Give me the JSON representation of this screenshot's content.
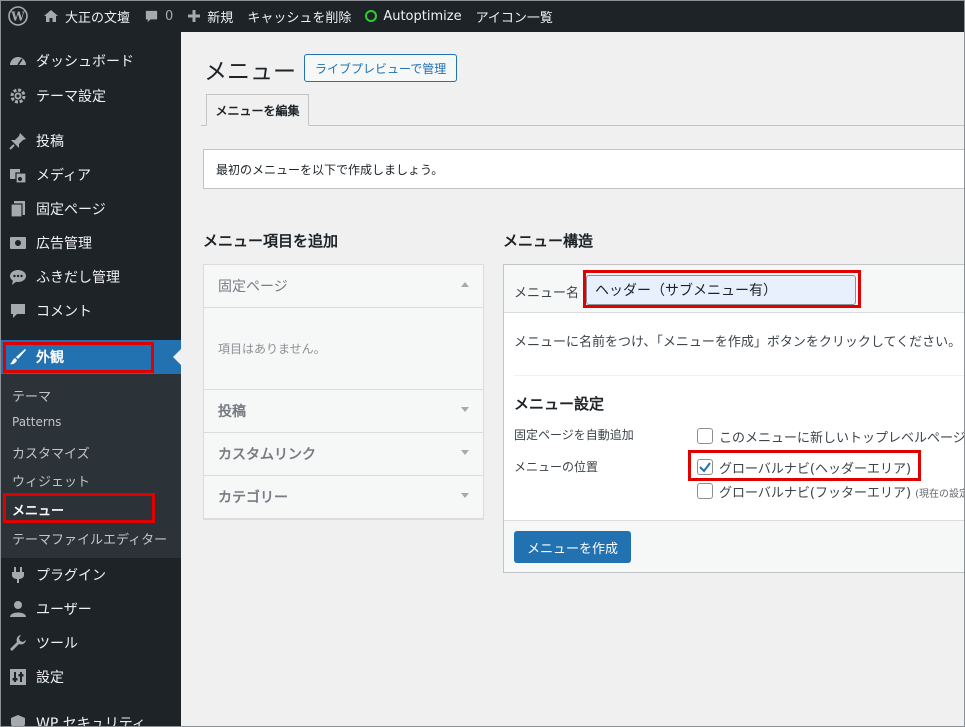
{
  "adminbar": {
    "site_name": "大正の文壇",
    "comments_count": "0",
    "new_label": "新規",
    "cache_label": "キャッシュを削除",
    "autoptimize_label": "Autoptimize",
    "icons_label": "アイコン一覧"
  },
  "sidebar": {
    "items": [
      {
        "label": "ダッシュボード",
        "icon": "dashboard-icon"
      },
      {
        "label": "テーマ設定",
        "icon": "gear-icon"
      },
      {
        "label": "投稿",
        "icon": "pin-icon"
      },
      {
        "label": "メディア",
        "icon": "media-icon"
      },
      {
        "label": "固定ページ",
        "icon": "page-icon"
      },
      {
        "label": "広告管理",
        "icon": "ad-icon"
      },
      {
        "label": "ふきだし管理",
        "icon": "speech-bubble-icon"
      },
      {
        "label": "コメント",
        "icon": "comment-icon"
      },
      {
        "label": "外観",
        "icon": "brush-icon"
      },
      {
        "label": "プラグイン",
        "icon": "plugin-icon"
      },
      {
        "label": "ユーザー",
        "icon": "user-icon"
      },
      {
        "label": "ツール",
        "icon": "wrench-icon"
      },
      {
        "label": "設定",
        "icon": "settings-icon"
      },
      {
        "label": "WP セキュリティ",
        "icon": "shield-icon"
      }
    ],
    "submenu": [
      "テーマ",
      "Patterns",
      "カスタマイズ",
      "ウィジェット",
      "メニュー",
      "テーマファイルエディター"
    ]
  },
  "main": {
    "title": "メニュー",
    "live_preview_button": "ライブプレビューで管理",
    "tab_edit": "メニューを編集",
    "notice": "最初のメニューを以下で作成しましょう。",
    "add_items_heading": "メニュー項目を追加",
    "structure_heading": "メニュー構造",
    "accordion": [
      {
        "label": "固定ページ"
      },
      {
        "label": "投稿"
      },
      {
        "label": "カスタムリンク"
      },
      {
        "label": "カテゴリー"
      }
    ],
    "accordion_empty": "項目はありません。",
    "menu_name_label": "メニュー名",
    "menu_name_value": "ヘッダー（サブメニュー有）",
    "menu_hint": "メニューに名前をつけ、「メニューを作成」ボタンをクリックしてください。",
    "settings_heading": "メニュー設定",
    "auto_add_label": "固定ページを自動追加",
    "auto_add_option": "このメニューに新しいトップレベルページ",
    "location_label": "メニューの位置",
    "location_header": "グローバルナビ(ヘッダーエリア)",
    "location_footer": "グローバルナビ(フッターエリア)",
    "location_footer_note": "(現在の設定",
    "create_button": "メニューを作成"
  },
  "colors": {
    "admin_dark": "#1d2327",
    "accent_blue": "#2271b1",
    "highlight_red": "#e00000"
  }
}
